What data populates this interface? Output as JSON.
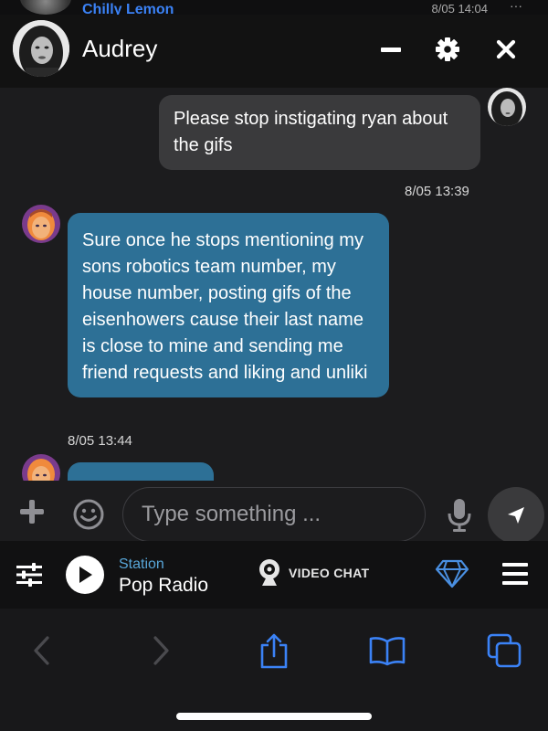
{
  "background_chat": {
    "name": "Chilly Lemon",
    "time": "8/05 14:04",
    "more": "···"
  },
  "header": {
    "contact_name": "Audrey"
  },
  "messages": [
    {
      "direction": "outgoing",
      "text": "Please stop instigating ryan about the gifs",
      "time": "8/05 13:39"
    },
    {
      "direction": "incoming",
      "text": "Sure once he stops mentioning my sons robotics team number, my house number, posting gifs of the eisenhowers cause their last name is close to mine and sending me friend requests and liking and unliki",
      "time": "8/05 13:44"
    },
    {
      "direction": "incoming",
      "text": ""
    }
  ],
  "composer": {
    "placeholder": "Type something ..."
  },
  "radio": {
    "label": "Station",
    "station_name": "Pop Radio",
    "video_chat_label": "VIDEO CHAT"
  },
  "colors": {
    "incoming_bubble": "#2d7096",
    "outgoing_bubble": "#3a3a3c",
    "accent_blue": "#3b82f6",
    "station_label": "#58a6d8"
  },
  "icons": {
    "header": [
      "minimize-icon",
      "gear-icon",
      "close-icon"
    ],
    "composer": [
      "plus-icon",
      "emoji-icon",
      "microphone-icon",
      "send-icon"
    ],
    "radio": [
      "equalizer-icon",
      "play-icon",
      "webcam-icon",
      "diamond-icon",
      "hamburger-menu-icon"
    ],
    "browser": [
      "back-icon",
      "forward-icon",
      "share-icon",
      "bookmarks-icon",
      "tabs-icon"
    ]
  }
}
